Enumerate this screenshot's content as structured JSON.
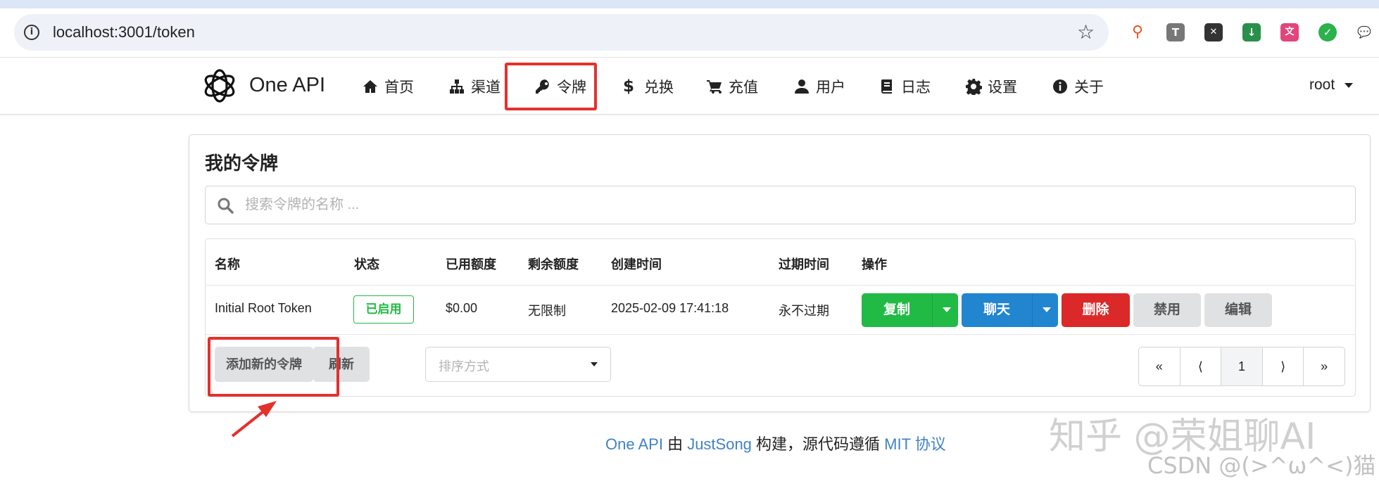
{
  "browser": {
    "url": "localhost:3001/token"
  },
  "nav": {
    "brand": "One API",
    "items": [
      {
        "label": "首页",
        "icon": "home-icon"
      },
      {
        "label": "渠道",
        "icon": "sitemap-icon"
      },
      {
        "label": "令牌",
        "icon": "key-icon"
      },
      {
        "label": "兑换",
        "icon": "dollar-icon"
      },
      {
        "label": "充值",
        "icon": "cart-icon"
      },
      {
        "label": "用户",
        "icon": "user-icon"
      },
      {
        "label": "日志",
        "icon": "book-icon"
      },
      {
        "label": "设置",
        "icon": "gear-icon"
      },
      {
        "label": "关于",
        "icon": "info-icon"
      }
    ],
    "user": "root"
  },
  "page": {
    "title": "我的令牌",
    "search_placeholder": "搜索令牌的名称 ..."
  },
  "table": {
    "headers": [
      "名称",
      "状态",
      "已用额度",
      "剩余额度",
      "创建时间",
      "过期时间",
      "操作"
    ],
    "rows": [
      {
        "name": "Initial Root Token",
        "status": "已启用",
        "used": "$0.00",
        "remaining": "无限制",
        "created": "2025-02-09 17:41:18",
        "expires": "永不过期"
      }
    ],
    "actions": {
      "copy": "复制",
      "chat": "聊天",
      "delete": "删除",
      "disable": "禁用",
      "edit": "编辑"
    }
  },
  "toolbar": {
    "add": "添加新的令牌",
    "refresh": "刷新",
    "sort_placeholder": "排序方式"
  },
  "pagination": {
    "first": "«",
    "prev": "⟨",
    "current": "1",
    "next": "⟩",
    "last": "»"
  },
  "footer": {
    "part1": "One API",
    "part2": " 由 ",
    "part3": "JustSong",
    "part4": " 构建，源代码遵循 ",
    "part5": "MIT 协议"
  },
  "watermark": {
    "line1": "知乎 @荣姐聊AI",
    "line2": "CSDN @(>^ω^<)猫"
  },
  "colors": {
    "green": "#21ba45",
    "blue": "#2185d0",
    "red": "#db2828",
    "annotation": "#e5302c",
    "link": "#4183c4"
  }
}
